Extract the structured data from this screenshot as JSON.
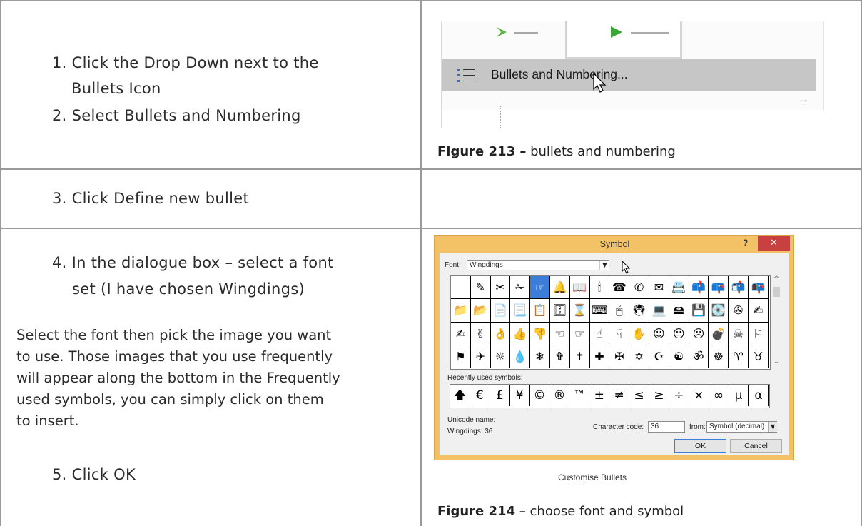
{
  "row1": {
    "step1_line1": "1. Click the Drop Down next to the",
    "step1_line2": "Bullets Icon",
    "step2": "2. Select Bullets and Numbering",
    "figure_screenshot": {
      "menu_label": "Bullets and Numbering..."
    },
    "caption_bold": "Figure 213 –",
    "caption_text": " bullets and numbering"
  },
  "row2": {
    "step3": "3. Click Define new bullet"
  },
  "row3": {
    "step4_line1": "4. In the dialogue box – select a font",
    "step4_line2": "set (I have chosen Wingdings)",
    "para_lines": [
      "Select the font then pick the image you want",
      "to use. Those images that you use frequently",
      "will appear along the bottom in the Frequently",
      "used symbols, you can simply click on them",
      "to insert."
    ],
    "step5": "5. Click OK",
    "symbol_dialog": {
      "title": "Symbol",
      "help": "?",
      "close": "✕",
      "font_label": "Font:",
      "font_value": "Wingdings",
      "symbols": [
        "",
        "✎",
        "✂",
        "✁",
        "☞",
        "🔔",
        "📖",
        "🕯",
        "☎",
        "✆",
        "✉",
        "📇",
        "📫",
        "📪",
        "📬",
        "📭",
        "📁",
        "📂",
        "📄",
        "📃",
        "📋",
        "🗄",
        "⌛",
        "⌨",
        "🖱",
        "🖲",
        "💻",
        "🖴",
        "💾",
        "💽",
        "✇",
        "✍",
        "✍",
        "✌",
        "👌",
        "👍",
        "👎",
        "☜",
        "☞",
        "☝",
        "☟",
        "✋",
        "☺",
        "😐",
        "☹",
        "💣",
        "☠",
        "⚐",
        "⚑",
        "✈",
        "☼",
        "💧",
        "❄",
        "✞",
        "✝",
        "✚",
        "✠",
        "✡",
        "☪",
        "☯",
        "ॐ",
        "☸",
        "♈",
        "♉"
      ],
      "recent_label": "Recently used symbols:",
      "recent": [
        "🡅",
        "€",
        "£",
        "¥",
        "©",
        "®",
        "™",
        "±",
        "≠",
        "≤",
        "≥",
        "÷",
        "×",
        "∞",
        "µ",
        "α"
      ],
      "unicode_label": "Unicode name:",
      "unicode_value": "Wingdings: 36",
      "charcode_label": "Character code:",
      "charcode_value": "36",
      "from_label": "from:",
      "from_value": "Symbol (decimal)",
      "ok": "OK",
      "cancel": "Cancel"
    },
    "figure_subtitle": "Customise Bullets",
    "caption_bold": "Figure 214",
    "caption_text": " – choose font and symbol"
  }
}
